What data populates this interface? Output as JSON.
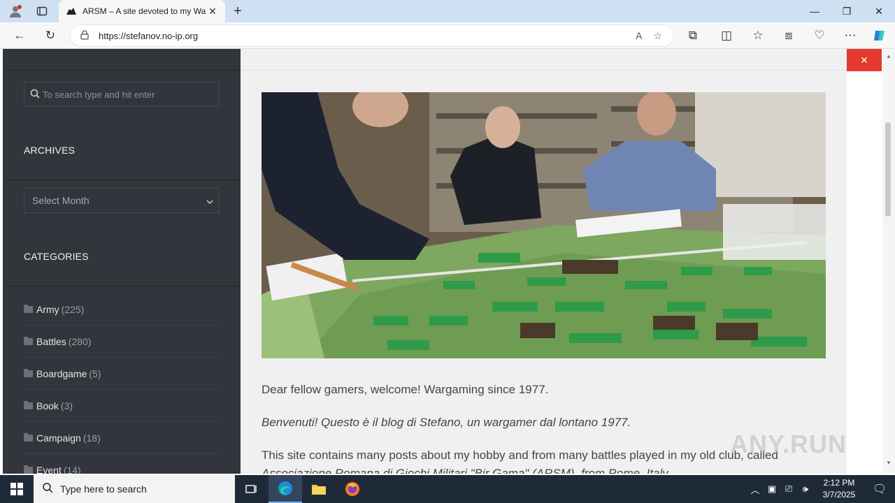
{
  "browser": {
    "tab_title": "ARSM – A site devoted to my Wa",
    "url": "https://stefanov.no-ip.org",
    "new_tab": "+",
    "tab_close": "✕"
  },
  "sidebar": {
    "search_placeholder": "To search type and hit enter",
    "archives_title": "ARCHIVES",
    "archives_select": "Select Month",
    "categories_title": "CATEGORIES",
    "categories": [
      {
        "label": "Army",
        "count": "(225)"
      },
      {
        "label": "Battles",
        "count": "(280)"
      },
      {
        "label": "Boardgame",
        "count": "(5)"
      },
      {
        "label": "Book",
        "count": "(3)"
      },
      {
        "label": "Campaign",
        "count": "(18)"
      },
      {
        "label": "Event",
        "count": "(14)"
      }
    ]
  },
  "main": {
    "para1": "Dear fellow gamers, welcome! Wargaming since 1977.",
    "para2": "Benvenuti! Questo è il blog di Stefano, un wargamer dal lontano 1977.",
    "para3": "This site contains many posts about my hobby and from many battles played in my old club, called",
    "para4": "Associazione Romana di Giochi Militari \"Bir Gama\" (ARSM), from Rome, Italy."
  },
  "watermark": "ANY.RUN",
  "taskbar": {
    "search_placeholder": "Type here to search",
    "time": "2:12 PM",
    "date": "3/7/2025"
  },
  "colors": {
    "sidebar_bg": "#32353b",
    "accent_red": "#e3392f",
    "taskbar_bg": "#1f2a38"
  }
}
